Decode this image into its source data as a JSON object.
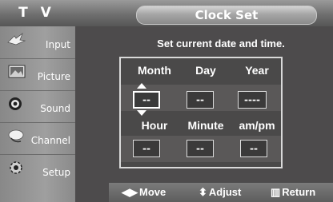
{
  "header": {
    "tv_label": "T V",
    "title": "Clock Set"
  },
  "sidebar": {
    "items": [
      {
        "label": "Input",
        "icon": "input-icon"
      },
      {
        "label": "Picture",
        "icon": "picture-icon"
      },
      {
        "label": "Sound",
        "icon": "sound-icon"
      },
      {
        "label": "Channel",
        "icon": "channel-icon"
      },
      {
        "label": "Setup",
        "icon": "setup-icon"
      }
    ]
  },
  "dialog": {
    "prompt": "Set current date and time.",
    "date_headers": [
      "Month",
      "Day",
      "Year"
    ],
    "date_values": [
      "--",
      "--",
      "----"
    ],
    "time_headers": [
      "Hour",
      "Minute",
      "am/pm"
    ],
    "time_values": [
      "--",
      "--",
      "--"
    ]
  },
  "footer": {
    "move": "Move",
    "adjust": "Adjust",
    "return": "Return"
  },
  "colors": {
    "background": "#4d4b4c",
    "sidebar": "#9f9f9f",
    "text": "#ffffff"
  }
}
